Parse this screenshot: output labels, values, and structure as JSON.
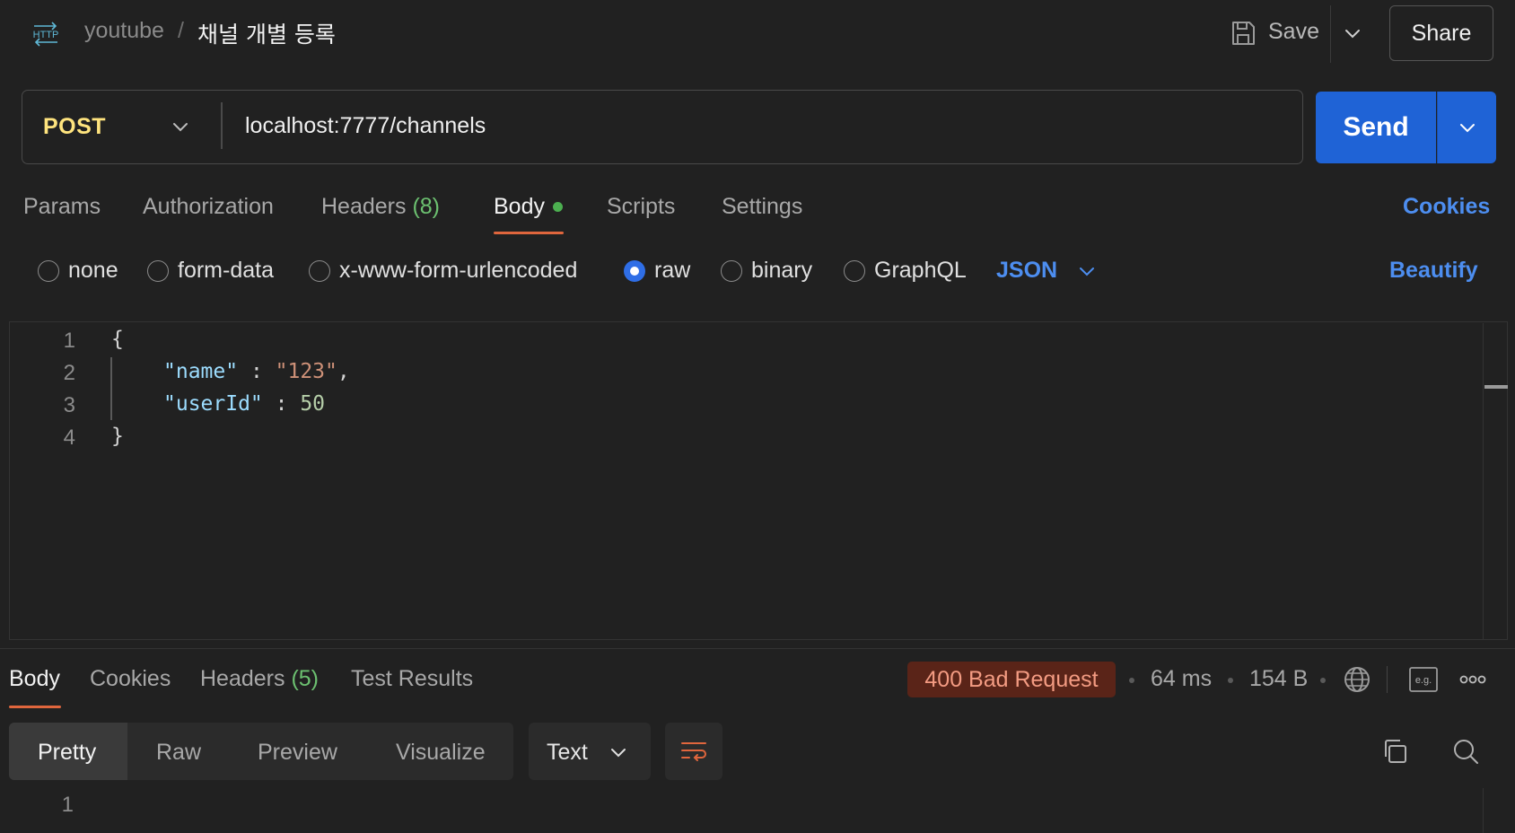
{
  "header": {
    "http_badge": "HTTP",
    "collection": "youtube",
    "separator": "/",
    "request_name": "채널 개별 등록",
    "save_label": "Save",
    "share_label": "Share"
  },
  "url_bar": {
    "method": "POST",
    "url": "localhost:7777/channels",
    "send_label": "Send"
  },
  "request_tabs": {
    "params": "Params",
    "authorization": "Authorization",
    "headers": "Headers",
    "headers_count": "(8)",
    "body": "Body",
    "scripts": "Scripts",
    "settings": "Settings",
    "active": "Body",
    "cookies": "Cookies"
  },
  "body_types": {
    "none": "none",
    "form_data": "form-data",
    "urlencoded": "x-www-form-urlencoded",
    "raw": "raw",
    "binary": "binary",
    "graphql": "GraphQL",
    "selected": "raw",
    "language": "JSON",
    "beautify": "Beautify"
  },
  "editor": {
    "line_numbers": [
      "1",
      "2",
      "3",
      "4"
    ],
    "open_brace": "{",
    "close_brace": "}",
    "fields": [
      {
        "key": "\"name\"",
        "sep": " : ",
        "value": "\"123\"",
        "trail": ",",
        "type": "string"
      },
      {
        "key": "\"userId\"",
        "sep": " : ",
        "value": "50",
        "trail": "",
        "type": "number"
      }
    ]
  },
  "response": {
    "tabs": {
      "body": "Body",
      "cookies": "Cookies",
      "headers": "Headers",
      "headers_count": "(5)",
      "test_results": "Test Results",
      "active": "Body"
    },
    "status": "400 Bad Request",
    "time": "64 ms",
    "size": "154 B",
    "eg_label": "e.g.",
    "views": {
      "pretty": "Pretty",
      "raw": "Raw",
      "preview": "Preview",
      "visualize": "Visualize",
      "active": "Pretty"
    },
    "format": "Text",
    "line_numbers": [
      "1"
    ]
  },
  "colors": {
    "accent_blue": "#1f63d6",
    "link_blue": "#4d8ef0",
    "method_yellow": "#ffe47e",
    "tab_underline": "#e0663d",
    "status_error_bg": "#5a2418",
    "status_error_text": "#f39b82",
    "count_green": "#6cc070"
  },
  "icons": [
    "http-icon",
    "save-icon",
    "chevron-down-icon",
    "globe-icon",
    "eg-icon",
    "more-icon",
    "wrap-lines-icon",
    "copy-icon",
    "search-icon"
  ]
}
